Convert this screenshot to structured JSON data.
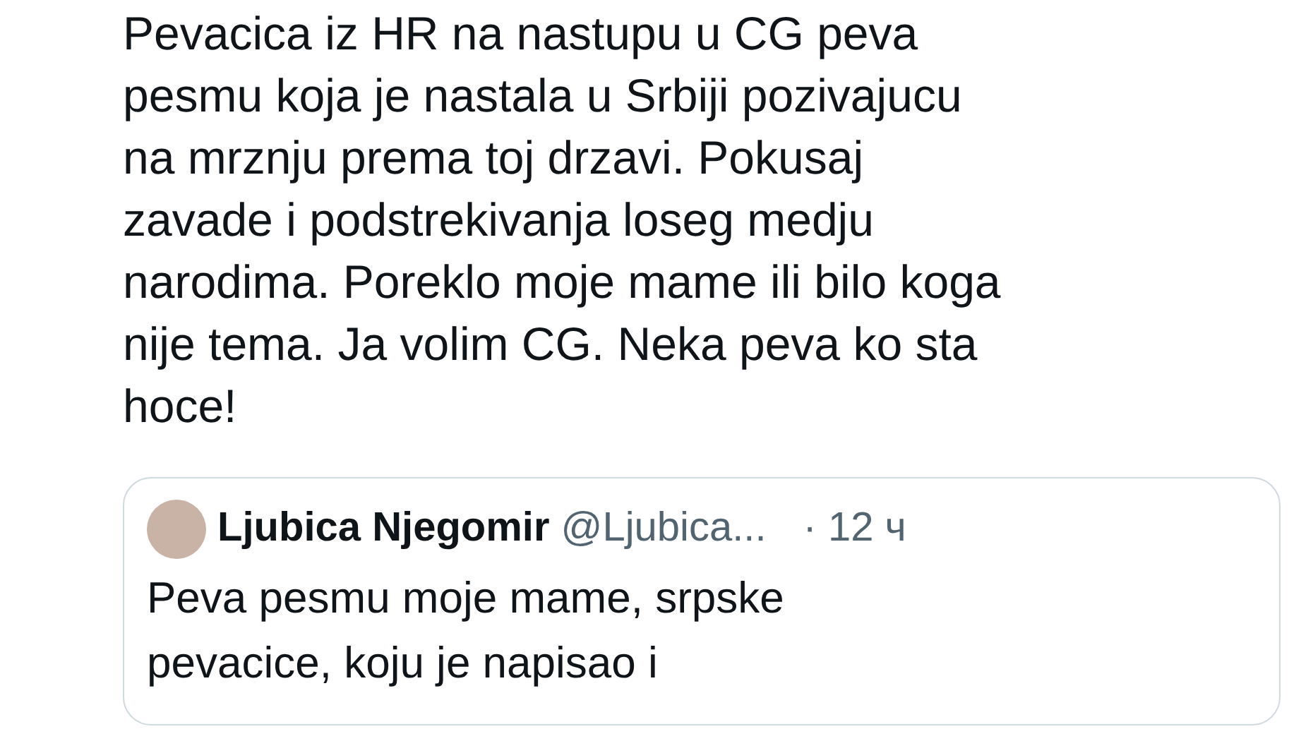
{
  "tweet": {
    "text_lines": [
      "Pevacica iz HR na nastupu u CG peva",
      "pesmu koja je nastala u Srbiji pozivajucu",
      "na mrznju prema toj drzavi. Pokusaj",
      "zavade i podstrekivanja loseg medju",
      "narodima. Poreklo moje mame ili bilo koga",
      "nije tema. Ja volim CG. Neka peva ko sta",
      "hoce!"
    ]
  },
  "quoted_tweet": {
    "author": "Ljubica Njegomir",
    "handle": "@Ljubica...",
    "time": "· 12 ч",
    "text_lines": [
      "Peva pesmu moje mame, srpske",
      "pevacice, koju je napisao i"
    ]
  }
}
